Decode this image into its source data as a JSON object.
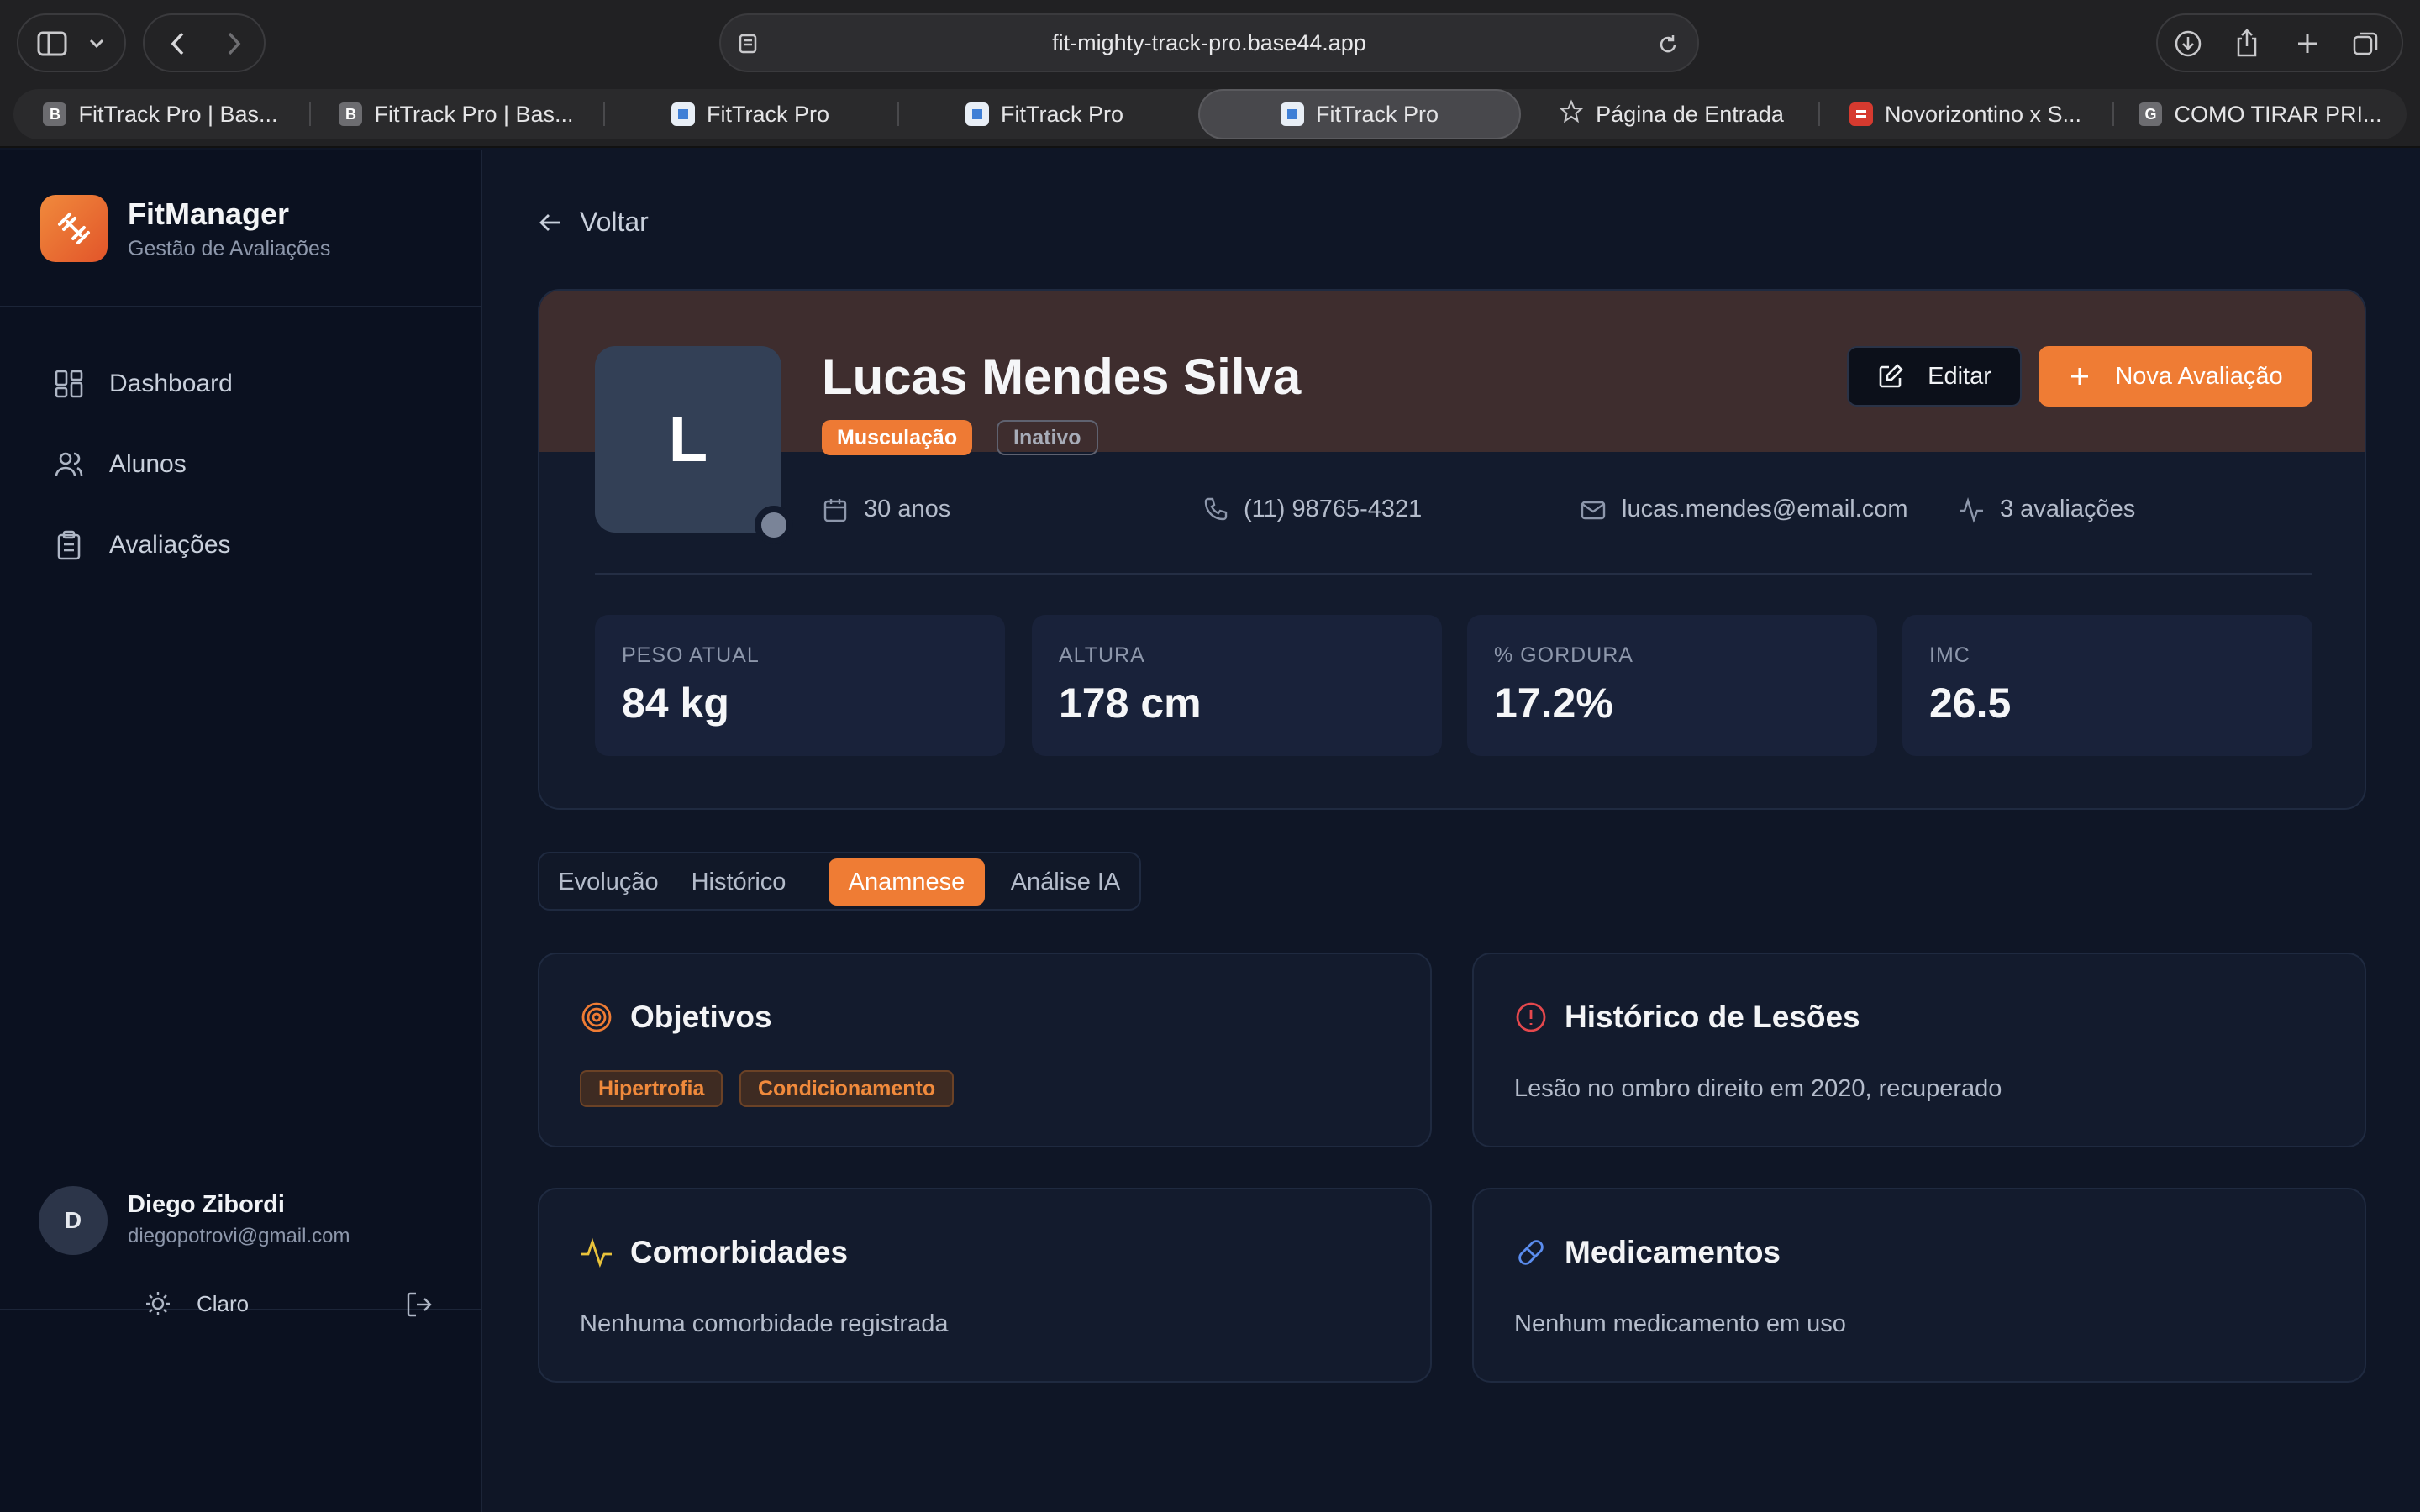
{
  "browser": {
    "url": "fit-mighty-track-pro.base44.app",
    "tabs": [
      {
        "label": "FitTrack Pro | Bas...",
        "favicon": "B"
      },
      {
        "label": "FitTrack Pro | Bas...",
        "favicon": "B"
      },
      {
        "label": "FitTrack Pro",
        "favicon": ""
      },
      {
        "label": "FitTrack Pro",
        "favicon": ""
      },
      {
        "label": "FitTrack Pro",
        "favicon": ""
      },
      {
        "label": "Página de Entrada",
        "favicon": "star-icon"
      },
      {
        "label": "Novorizontino x S...",
        "favicon": ""
      },
      {
        "label": "COMO TIRAR PRI...",
        "favicon": "G"
      }
    ]
  },
  "sidebar": {
    "brand": "FitManager",
    "subtitle": "Gestão de Avaliações",
    "nav": [
      {
        "label": "Dashboard",
        "icon": "dashboard-icon"
      },
      {
        "label": "Alunos",
        "icon": "users-icon"
      },
      {
        "label": "Avaliações",
        "icon": "clipboard-icon"
      }
    ],
    "user": {
      "initial": "D",
      "name": "Diego Zibordi",
      "email": "diegopotrovi@gmail.com"
    },
    "theme_label": "Claro"
  },
  "main": {
    "back_label": "Voltar",
    "profile": {
      "initial": "L",
      "name": "Lucas Mendes Silva",
      "badges": [
        "Musculação",
        "Inativo"
      ],
      "edit_label": "Editar",
      "new_label": "Nova Avaliação",
      "age": "30 anos",
      "phone": "(11) 98765-4321",
      "email": "lucas.mendes@email.com",
      "evaluations": "3 avaliações",
      "stats": [
        {
          "label": "PESO ATUAL",
          "value": "84 kg"
        },
        {
          "label": "ALTURA",
          "value": "178 cm"
        },
        {
          "label": "% GORDURA",
          "value": "17.2%"
        },
        {
          "label": "IMC",
          "value": "26.5"
        }
      ]
    },
    "tabs": [
      "Evolução",
      "Histórico",
      "Anamnese",
      "Análise IA"
    ],
    "active_tab": "Anamnese",
    "cards": {
      "objectives": {
        "title": "Objetivos",
        "tags": [
          "Hipertrofia",
          "Condicionamento"
        ]
      },
      "injuries": {
        "title": "Histórico de Lesões",
        "text": "Lesão no ombro direito em 2020, recuperado"
      },
      "comorbidities": {
        "title": "Comorbidades",
        "text": "Nenhuma comorbidade registrada"
      },
      "medications": {
        "title": "Medicamentos",
        "text": "Nenhum medicamento em uso"
      }
    }
  },
  "colors": {
    "accent": "#ef7c34",
    "background": "#0f1626",
    "sidebar": "#0b1120"
  }
}
